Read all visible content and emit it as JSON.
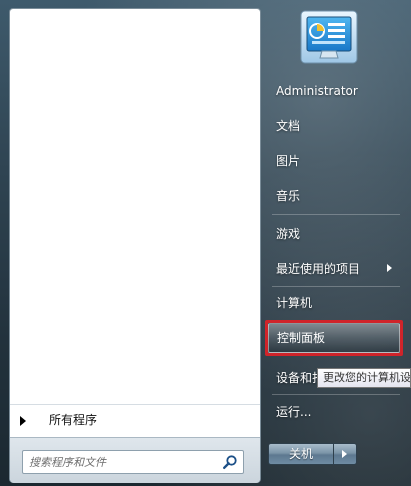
{
  "left_pane": {
    "all_programs_label": "所有程序",
    "search": {
      "placeholder": "搜索程序和文件"
    }
  },
  "right_pane": {
    "items": [
      {
        "label": "Administrator"
      },
      {
        "label": "文档"
      },
      {
        "label": "图片"
      },
      {
        "label": "音乐"
      },
      {
        "label": "游戏"
      },
      {
        "label": "最近使用的项目"
      },
      {
        "label": "计算机"
      },
      {
        "label": "控制面板"
      },
      {
        "label": "设备和打"
      },
      {
        "label": "运行..."
      }
    ],
    "tooltip": "更改您的计算机设置",
    "shutdown_label": "关机"
  },
  "colors": {
    "highlight_border": "#d0242a"
  },
  "icons": {
    "avatar": "control-panel-avatar-icon",
    "search": "search-icon",
    "submenu": "chevron-right-icon",
    "all_programs": "triangle-right-icon"
  }
}
